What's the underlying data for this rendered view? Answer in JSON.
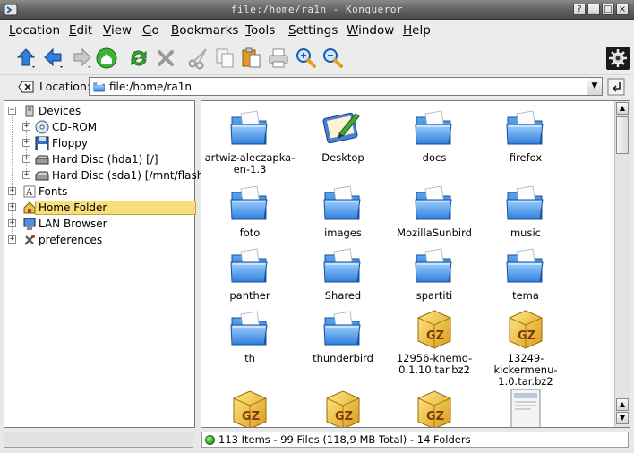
{
  "window": {
    "title": "file:/home/ra1n - Konqueror",
    "buttons": [
      "?",
      "_",
      "□",
      "×"
    ]
  },
  "menu": [
    "Location",
    "Edit",
    "View",
    "Go",
    "Bookmarks",
    "Tools",
    "Settings",
    "Window",
    "Help"
  ],
  "toolbar": [
    "up-icon",
    "back-icon",
    "forward-icon",
    "home-icon",
    "reload-icon",
    "stop-icon",
    "cut-icon",
    "copy-icon",
    "paste-icon",
    "print-icon",
    "zoom-in-icon",
    "zoom-out-icon",
    "konqueror-gear-icon"
  ],
  "location": {
    "label": "Location:",
    "value": "file:/home/ra1n"
  },
  "sidebar": {
    "devices": "Devices",
    "cdrom": "CD-ROM",
    "floppy": "Floppy",
    "hda1": "Hard Disc (hda1) [/]",
    "sda1": "Hard Disc (sda1) [/mnt/flash]",
    "fonts": "Fonts",
    "home": "Home Folder",
    "lan": "LAN Browser",
    "prefs": "preferences"
  },
  "files": [
    {
      "name": "artwiz-aleczapka-en-1.3",
      "type": "folder"
    },
    {
      "name": "Desktop",
      "type": "desktop"
    },
    {
      "name": "docs",
      "type": "folder"
    },
    {
      "name": "firefox",
      "type": "folder"
    },
    {
      "name": "foto",
      "type": "folder"
    },
    {
      "name": "images",
      "type": "folder"
    },
    {
      "name": "MozillaSunbird",
      "type": "folder"
    },
    {
      "name": "music",
      "type": "folder"
    },
    {
      "name": "panther",
      "type": "folder"
    },
    {
      "name": "Shared",
      "type": "folder"
    },
    {
      "name": "spartiti",
      "type": "folder"
    },
    {
      "name": "tema",
      "type": "folder"
    },
    {
      "name": "th",
      "type": "folder"
    },
    {
      "name": "thunderbird",
      "type": "folder"
    },
    {
      "name": "12956-knemo-0.1.10.tar.bz2",
      "type": "archive"
    },
    {
      "name": "13249-kickermenu-1.0.tar.bz2",
      "type": "archive"
    },
    {
      "name": "",
      "type": "archive"
    },
    {
      "name": "",
      "type": "archive"
    },
    {
      "name": "",
      "type": "archive"
    },
    {
      "name": "",
      "type": "document"
    }
  ],
  "status": {
    "text": "113 Items - 99 Files (118,9 MB Total) - 14 Folders"
  }
}
